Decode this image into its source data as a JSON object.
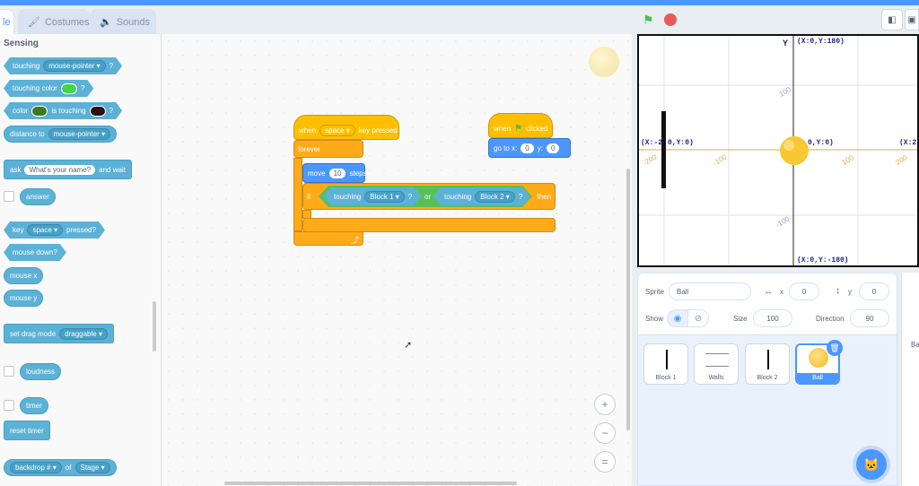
{
  "tabs": [
    {
      "label": "le",
      "active": true
    },
    {
      "label": "Costumes",
      "icon": "brush-icon"
    },
    {
      "label": "Sounds",
      "icon": "speaker-icon"
    }
  ],
  "palette": {
    "title": "Sensing",
    "touching": {
      "label": "touching",
      "target": "mouse-pointer ▾",
      "q": "?"
    },
    "touching_color": {
      "label": "touching color",
      "q": "?",
      "color": "#44d44a"
    },
    "color_touching": {
      "label": "color",
      "mid": "is touching",
      "q": "?",
      "color1": "#3a7a1e",
      "color2": "#2a1010"
    },
    "distance": {
      "label": "distance to",
      "target": "mouse-pointer ▾"
    },
    "ask": {
      "label": "ask",
      "question": "What's your name?",
      "tail": "and wait"
    },
    "answer": "answer",
    "key": {
      "label": "key",
      "key": "space ▾",
      "tail": "pressed?"
    },
    "mouse_down": "mouse down?",
    "mouse_x": "mouse x",
    "mouse_y": "mouse y",
    "drag": {
      "label": "set drag mode",
      "mode": "draggable ▾"
    },
    "loudness": "loudness",
    "timer": "timer",
    "reset_timer": "reset timer",
    "backdrop": {
      "attr": "backdrop # ▾",
      "of": "of",
      "target": "Stage ▾"
    }
  },
  "script1": {
    "when": "when",
    "key": "space ▾",
    "pressed": "key pressed",
    "forever": "forever",
    "move": "move",
    "steps_value": "10",
    "steps": "steps",
    "if": "if",
    "touching1": "touching",
    "block1": "Block 1 ▾",
    "q1": "?",
    "or": "or",
    "touching2": "touching",
    "block2": "Block 2 ▾",
    "q2": "?",
    "then": "then",
    "loop_arrow": "⤴"
  },
  "script2": {
    "when": "when",
    "clicked": "clicked",
    "goto": "go to x:",
    "x": "0",
    "y_label": "y:",
    "y": "0"
  },
  "zoom": {
    "in": "+",
    "out": "−",
    "reset": "="
  },
  "stage_labels": {
    "y_axis": "Y",
    "top": "(X:0,Y:180)",
    "bottom": "(X:0,Y:-180)",
    "left": "(X:-2",
    "left_hidden": "0,Y:0)",
    "center": "0,Y:0)",
    "right": "(X:2",
    "tick_pos_y": "100",
    "tick_neg_y": "-100",
    "tick_neg_x_far": "-200",
    "tick_neg_x": "-100",
    "tick_pos_x": "100",
    "tick_pos_x_far": "200"
  },
  "sprite_info": {
    "sprite_label": "Sprite",
    "sprite_name": "Ball",
    "x_label": "x",
    "x_value": "0",
    "y_label": "y",
    "y_value": "0",
    "show_label": "Show",
    "size_label": "Size",
    "size_value": "100",
    "direction_label": "Direction",
    "direction_value": "90"
  },
  "sprites": [
    "Block 1",
    "Walls",
    "Block 2",
    "Ball"
  ],
  "right_label": "Ba",
  "colors": {
    "accent": "#4c97ff",
    "events": "#ffbf00",
    "control": "#ffab19",
    "sensing": "#5cb1d6",
    "operators": "#59c059"
  }
}
